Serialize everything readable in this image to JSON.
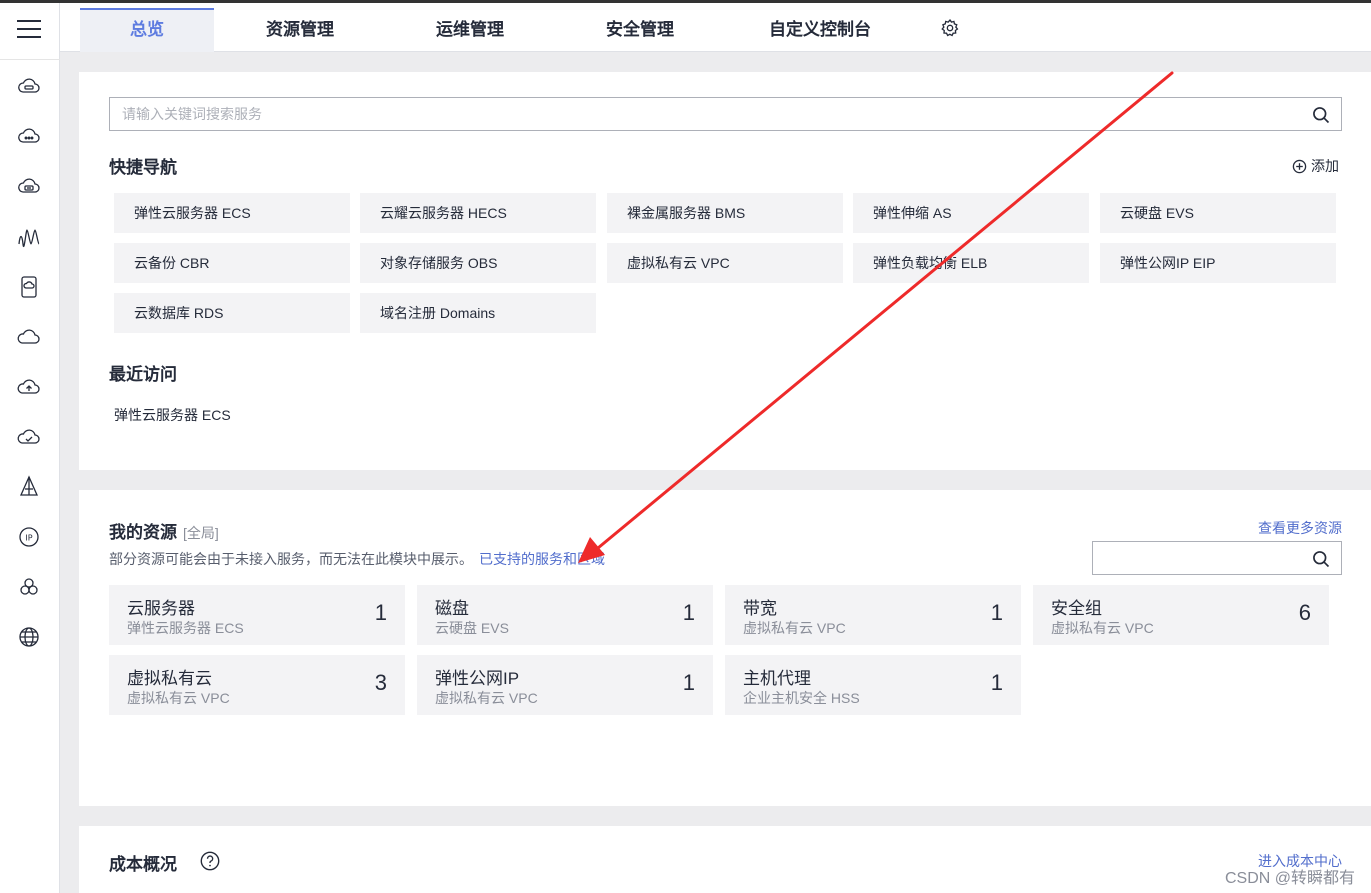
{
  "tabs": [
    {
      "label": "总览",
      "active": true
    },
    {
      "label": "资源管理"
    },
    {
      "label": "运维管理"
    },
    {
      "label": "安全管理"
    },
    {
      "label": "自定义控制台"
    }
  ],
  "nav_icons": [
    "ecs-cloud-icon",
    "cloud-icon",
    "storage-icon",
    "wave-icon",
    "phone-icon",
    "cloud-outline-icon",
    "cloud-upload-icon",
    "cloud-check-icon",
    "tower-icon",
    "ip-icon",
    "cluster-icon",
    "globe-icon"
  ],
  "search": {
    "placeholder": "请输入关键词搜索服务"
  },
  "quick_nav": {
    "title": "快捷导航",
    "add_label": "添加",
    "items": [
      "弹性云服务器 ECS",
      "云耀云服务器 HECS",
      "裸金属服务器 BMS",
      "弹性伸缩 AS",
      "云硬盘 EVS",
      "云备份 CBR",
      "对象存储服务 OBS",
      "虚拟私有云 VPC",
      "弹性负载均衡 ELB",
      "弹性公网IP EIP",
      "云数据库 RDS",
      "域名注册 Domains"
    ]
  },
  "recent": {
    "title": "最近访问",
    "items": [
      "弹性云服务器 ECS"
    ]
  },
  "resources": {
    "title": "我的资源",
    "scope": "[全局]",
    "desc": "部分资源可能会由于未接入服务，而无法在此模块中展示。",
    "desc_link": "已支持的服务和区域",
    "more_link": "查看更多资源",
    "items": [
      {
        "name": "云服务器",
        "sub": "弹性云服务器 ECS",
        "count": "1"
      },
      {
        "name": "磁盘",
        "sub": "云硬盘 EVS",
        "count": "1"
      },
      {
        "name": "带宽",
        "sub": "虚拟私有云 VPC",
        "count": "1"
      },
      {
        "name": "安全组",
        "sub": "虚拟私有云 VPC",
        "count": "6"
      },
      {
        "name": "虚拟私有云",
        "sub": "虚拟私有云 VPC",
        "count": "3"
      },
      {
        "name": "弹性公网IP",
        "sub": "虚拟私有云 VPC",
        "count": "1"
      },
      {
        "name": "主机代理",
        "sub": "企业主机安全 HSS",
        "count": "1"
      }
    ]
  },
  "cost": {
    "title": "成本概况",
    "link": "进入成本中心"
  },
  "watermark": "CSDN @转瞬都有",
  "colors": {
    "accent": "#5e7ce0",
    "link": "#526ecc",
    "arrow": "#ee2a2a"
  }
}
